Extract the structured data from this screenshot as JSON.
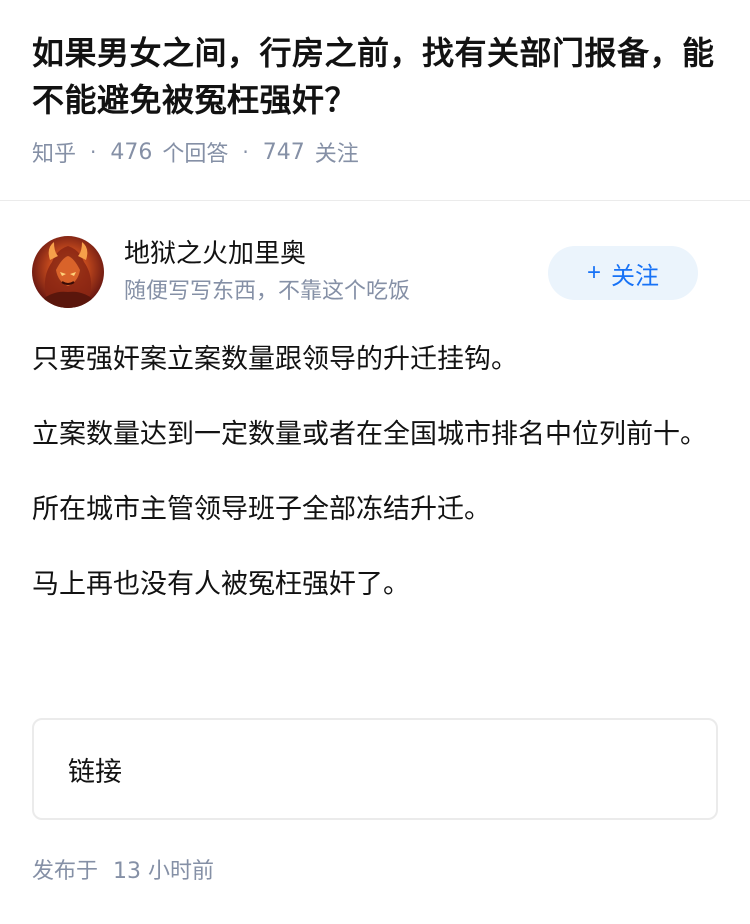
{
  "question": {
    "title": "如果男女之间，行房之前，找有关部门报备，能不能避免被冤枉强奸？",
    "source": "知乎",
    "answer_count": "476",
    "answer_label": "个回答",
    "follower_count": "747",
    "follower_label": "关注",
    "separator": "·"
  },
  "author": {
    "name": "地狱之火加里奥",
    "bio": "随便写写东西，不靠这个吃饭",
    "avatar_icon": "avatar-fire-character",
    "follow_plus": "+",
    "follow_label": "关注"
  },
  "answer": {
    "paragraphs": [
      "只要强奸案立案数量跟领导的升迁挂钩。",
      "立案数量达到一定数量或者在全国城市排名中位列前十。",
      "所在城市主管领导班子全部冻结升迁。",
      "马上再也没有人被冤枉强奸了。"
    ],
    "link_label": "链接",
    "publish_prefix": "发布于",
    "publish_time": "13 小时前"
  },
  "colors": {
    "accent": "#1772f6",
    "follow_bg": "#ebf4fc",
    "meta_gray": "#8590a6",
    "text": "#121212",
    "border": "#ebebeb"
  }
}
